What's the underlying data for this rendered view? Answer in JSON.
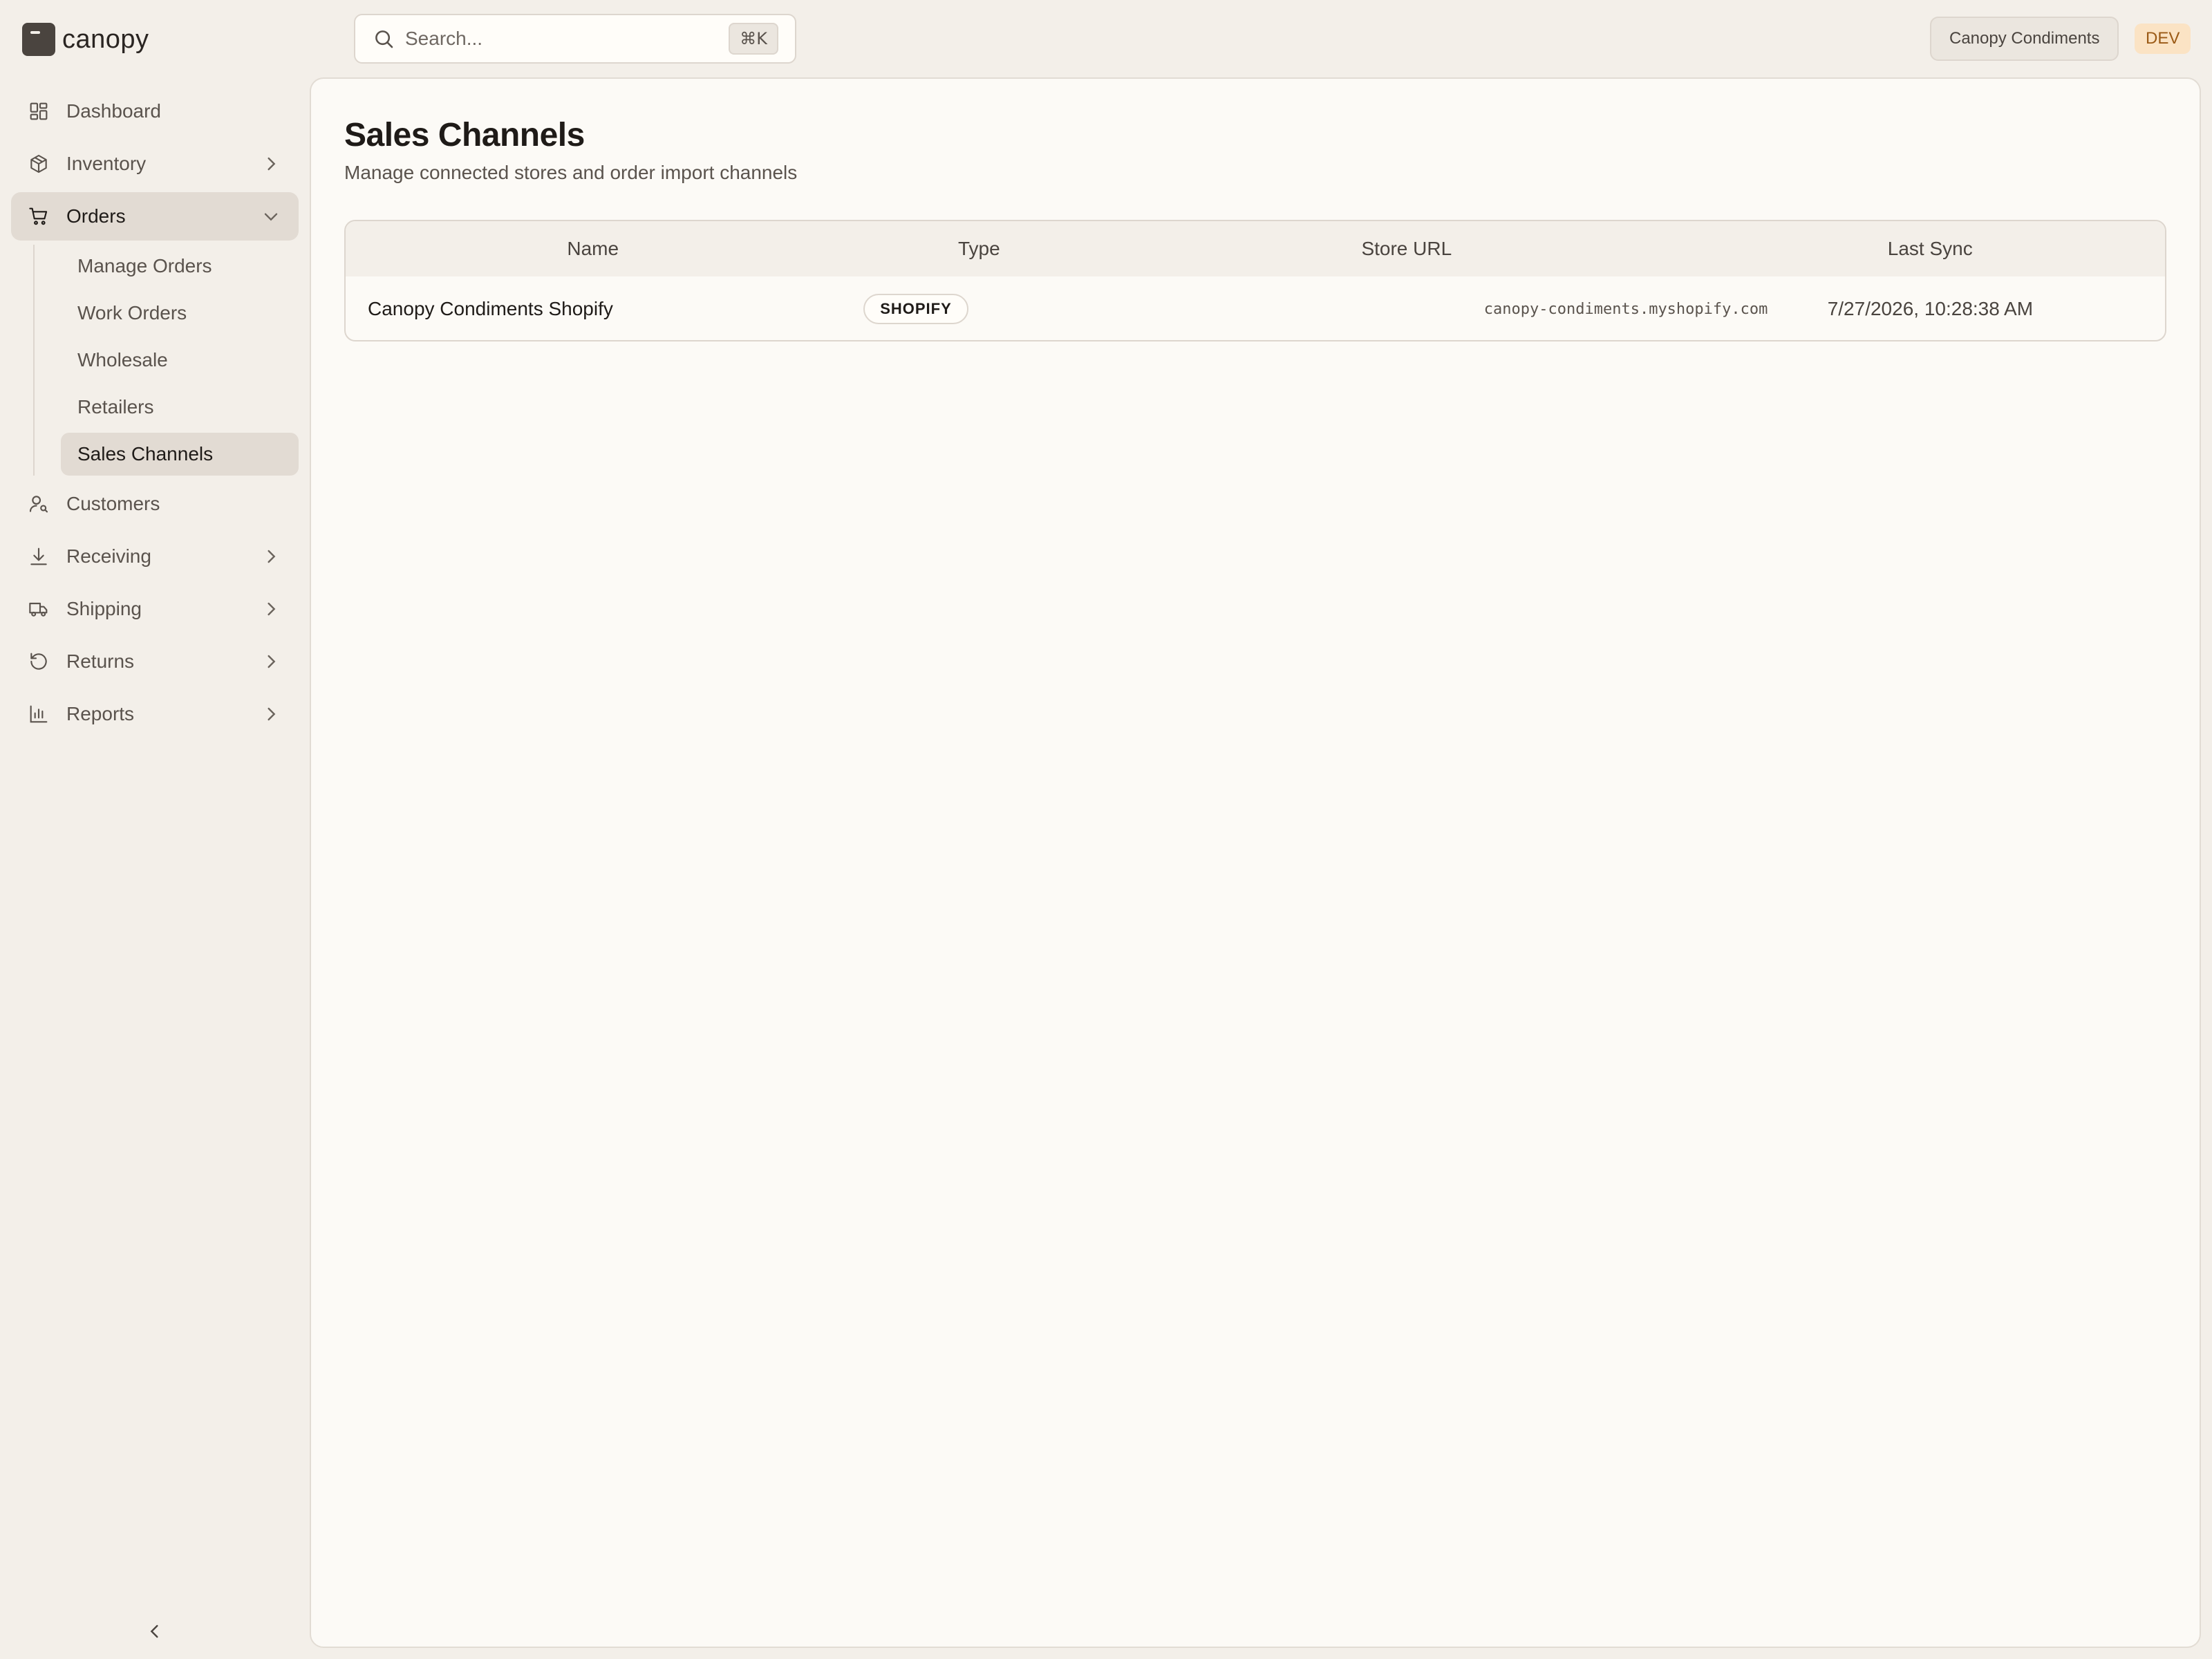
{
  "app": {
    "logo_text": "canopy"
  },
  "sidebar": {
    "items": [
      {
        "label": "Dashboard",
        "icon": "dashboard-icon"
      },
      {
        "label": "Inventory",
        "icon": "box-icon"
      },
      {
        "label": "Orders",
        "icon": "cart-icon",
        "expanded": true,
        "children": [
          {
            "label": "Manage Orders"
          },
          {
            "label": "Work Orders"
          },
          {
            "label": "Wholesale"
          },
          {
            "label": "Retailers"
          },
          {
            "label": "Sales Channels",
            "active": true
          }
        ]
      },
      {
        "label": "Customers",
        "icon": "user-search-icon"
      },
      {
        "label": "Receiving",
        "icon": "download-icon"
      },
      {
        "label": "Shipping",
        "icon": "truck-icon"
      },
      {
        "label": "Returns",
        "icon": "undo-icon"
      },
      {
        "label": "Reports",
        "icon": "bar-chart-icon"
      }
    ]
  },
  "topbar": {
    "search": {
      "placeholder": "Search...",
      "shortcut": "⌘K"
    },
    "org_name": "Canopy Condiments",
    "env_badge": "DEV"
  },
  "page": {
    "title": "Sales Channels",
    "subtitle": "Manage connected stores and order import channels"
  },
  "table": {
    "headers": {
      "name": "Name",
      "type": "Type",
      "store_url": "Store URL",
      "last_sync": "Last Sync"
    },
    "rows": [
      {
        "name": "Canopy Condiments Shopify",
        "type": "SHOPIFY",
        "store_url": "canopy-condiments.myshopify.com",
        "last_sync": "7/27/2026, 10:28:38 AM"
      }
    ]
  },
  "colors": {
    "background": "#f3efe9",
    "panel": "#fcfaf6",
    "active_nav": "#e2dbd3",
    "dev_badge_bg": "#fbe3c4",
    "dev_badge_text": "#9b5a16"
  }
}
